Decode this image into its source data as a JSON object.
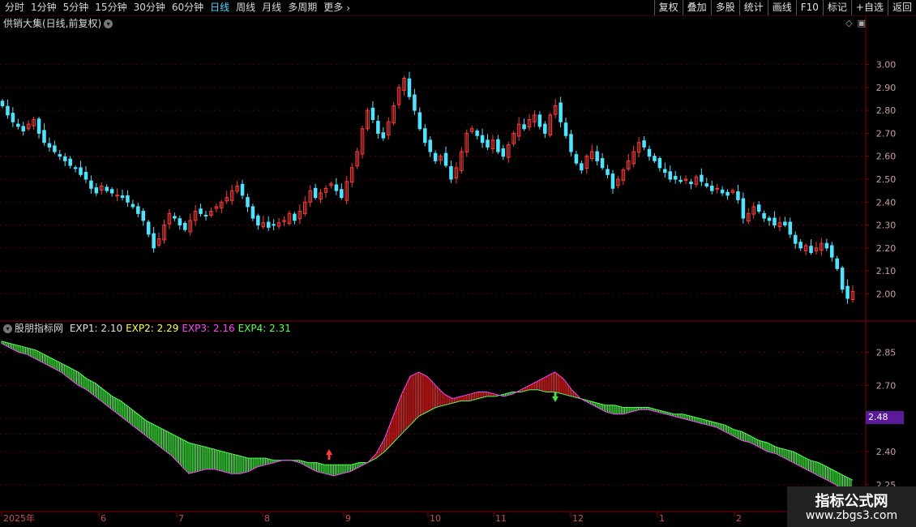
{
  "toolbar": {
    "periods": [
      "分时",
      "1分钟",
      "5分钟",
      "15分钟",
      "30分钟",
      "60分钟",
      "日线",
      "周线",
      "月线",
      "多周期",
      "更多"
    ],
    "more_arrow": "›",
    "active_period": "日线",
    "actions": [
      "复权",
      "叠加",
      "多股",
      "统计",
      "画线",
      "F10",
      "标记",
      "+自选",
      "返回"
    ]
  },
  "main_panel": {
    "title": "供销大集(日线,前复权)",
    "price_ticks": [
      "3.00",
      "2.90",
      "2.80",
      "2.70",
      "2.60",
      "2.50",
      "2.40",
      "2.30",
      "2.20",
      "2.10",
      "2.00"
    ],
    "up_color": "#ff3b3b",
    "down_color": "#4fe3ff"
  },
  "indicator_panel": {
    "name": "股朋指标网",
    "legend": [
      {
        "label": "EXP1: 2.10",
        "color": "#e0e0e0"
      },
      {
        "label": "EXP2: 2.29",
        "color": "#ffff55"
      },
      {
        "label": "EXP3: 2.16",
        "color": "#ff44ff"
      },
      {
        "label": "EXP4: 2.31",
        "color": "#55ff55"
      }
    ],
    "value_ticks": [
      "2.85",
      "2.70",
      "2.55",
      "2.40",
      "2.25"
    ],
    "current_value": "2.48",
    "up_fill": "#ff2020",
    "down_fill": "#44ff44"
  },
  "time_axis": {
    "labels": [
      "2025年",
      "6",
      "7",
      "8",
      "9",
      "10",
      "11",
      "12",
      "1",
      "2"
    ]
  },
  "watermark": {
    "title": "指标公式网",
    "url": "www.zbgs3.com"
  },
  "chart_data": [
    {
      "type": "candlestick",
      "title": "供销大集(日线,前复权)",
      "ylim": [
        1.92,
        3.14
      ],
      "closes": [
        2.82,
        2.78,
        2.75,
        2.73,
        2.71,
        2.74,
        2.76,
        2.7,
        2.66,
        2.64,
        2.62,
        2.6,
        2.58,
        2.56,
        2.55,
        2.52,
        2.5,
        2.46,
        2.44,
        2.47,
        2.45,
        2.44,
        2.43,
        2.42,
        2.4,
        2.38,
        2.35,
        2.32,
        2.26,
        2.2,
        2.24,
        2.3,
        2.35,
        2.33,
        2.3,
        2.28,
        2.32,
        2.36,
        2.35,
        2.34,
        2.36,
        2.38,
        2.4,
        2.42,
        2.45,
        2.47,
        2.43,
        2.38,
        2.33,
        2.3,
        2.31,
        2.29,
        2.3,
        2.31,
        2.32,
        2.35,
        2.32,
        2.36,
        2.4,
        2.45,
        2.42,
        2.44,
        2.46,
        2.48,
        2.45,
        2.42,
        2.49,
        2.55,
        2.62,
        2.72,
        2.8,
        2.76,
        2.7,
        2.68,
        2.75,
        2.82,
        2.9,
        2.94,
        2.86,
        2.8,
        2.72,
        2.66,
        2.62,
        2.58,
        2.6,
        2.56,
        2.5,
        2.55,
        2.62,
        2.7,
        2.72,
        2.69,
        2.66,
        2.64,
        2.67,
        2.62,
        2.6,
        2.65,
        2.7,
        2.74,
        2.72,
        2.76,
        2.78,
        2.73,
        2.7,
        2.78,
        2.82,
        2.75,
        2.69,
        2.62,
        2.57,
        2.54,
        2.6,
        2.62,
        2.58,
        2.55,
        2.52,
        2.46,
        2.5,
        2.54,
        2.58,
        2.62,
        2.66,
        2.64,
        2.6,
        2.58,
        2.55,
        2.53,
        2.5,
        2.5,
        2.49,
        2.5,
        2.48,
        2.51,
        2.49,
        2.47,
        2.45,
        2.46,
        2.44,
        2.43,
        2.45,
        2.41,
        2.33,
        2.35,
        2.38,
        2.36,
        2.33,
        2.32,
        2.3,
        2.31,
        2.3,
        2.26,
        2.22,
        2.2,
        2.21,
        2.18,
        2.2,
        2.22,
        2.2,
        2.16,
        2.11,
        2.02,
        1.98,
        2.01
      ]
    },
    {
      "type": "line",
      "title": "股朋指标网",
      "ylim": [
        2.15,
        2.94
      ],
      "series": [
        {
          "name": "EXP1",
          "values": [
            2.89,
            2.87,
            2.85,
            2.84,
            2.82,
            2.8,
            2.78,
            2.76,
            2.73,
            2.7,
            2.68,
            2.65,
            2.62,
            2.59,
            2.56,
            2.53,
            2.5,
            2.47,
            2.44,
            2.41,
            2.38,
            2.34,
            2.3,
            2.31,
            2.32,
            2.32,
            2.31,
            2.3,
            2.3,
            2.31,
            2.33,
            2.34,
            2.35,
            2.36,
            2.36,
            2.35,
            2.33,
            2.31,
            2.3,
            2.29,
            2.3,
            2.31,
            2.33,
            2.35,
            2.39,
            2.46,
            2.56,
            2.66,
            2.74,
            2.76,
            2.74,
            2.7,
            2.66,
            2.64,
            2.65,
            2.66,
            2.67,
            2.67,
            2.66,
            2.65,
            2.66,
            2.68,
            2.7,
            2.72,
            2.74,
            2.76,
            2.73,
            2.68,
            2.64,
            2.62,
            2.6,
            2.58,
            2.57,
            2.57,
            2.58,
            2.59,
            2.59,
            2.58,
            2.57,
            2.56,
            2.55,
            2.54,
            2.53,
            2.52,
            2.51,
            2.49,
            2.47,
            2.45,
            2.44,
            2.42,
            2.4,
            2.39,
            2.37,
            2.35,
            2.33,
            2.31,
            2.29,
            2.27,
            2.25,
            2.22,
            2.18
          ]
        },
        {
          "name": "EXP4",
          "values": [
            2.9,
            2.89,
            2.88,
            2.87,
            2.86,
            2.84,
            2.82,
            2.8,
            2.78,
            2.76,
            2.73,
            2.71,
            2.68,
            2.65,
            2.63,
            2.6,
            2.57,
            2.54,
            2.52,
            2.5,
            2.48,
            2.46,
            2.44,
            2.43,
            2.42,
            2.41,
            2.4,
            2.39,
            2.38,
            2.37,
            2.37,
            2.37,
            2.36,
            2.36,
            2.36,
            2.36,
            2.35,
            2.35,
            2.34,
            2.34,
            2.34,
            2.34,
            2.35,
            2.35,
            2.37,
            2.4,
            2.44,
            2.48,
            2.52,
            2.56,
            2.58,
            2.6,
            2.61,
            2.62,
            2.63,
            2.63,
            2.64,
            2.65,
            2.65,
            2.66,
            2.67,
            2.67,
            2.68,
            2.68,
            2.67,
            2.67,
            2.66,
            2.65,
            2.64,
            2.63,
            2.62,
            2.61,
            2.61,
            2.6,
            2.6,
            2.6,
            2.6,
            2.59,
            2.58,
            2.57,
            2.57,
            2.56,
            2.55,
            2.54,
            2.53,
            2.52,
            2.5,
            2.49,
            2.47,
            2.45,
            2.44,
            2.42,
            2.41,
            2.4,
            2.38,
            2.36,
            2.35,
            2.33,
            2.31,
            2.29,
            2.27
          ]
        }
      ],
      "hline": 2.48
    }
  ]
}
